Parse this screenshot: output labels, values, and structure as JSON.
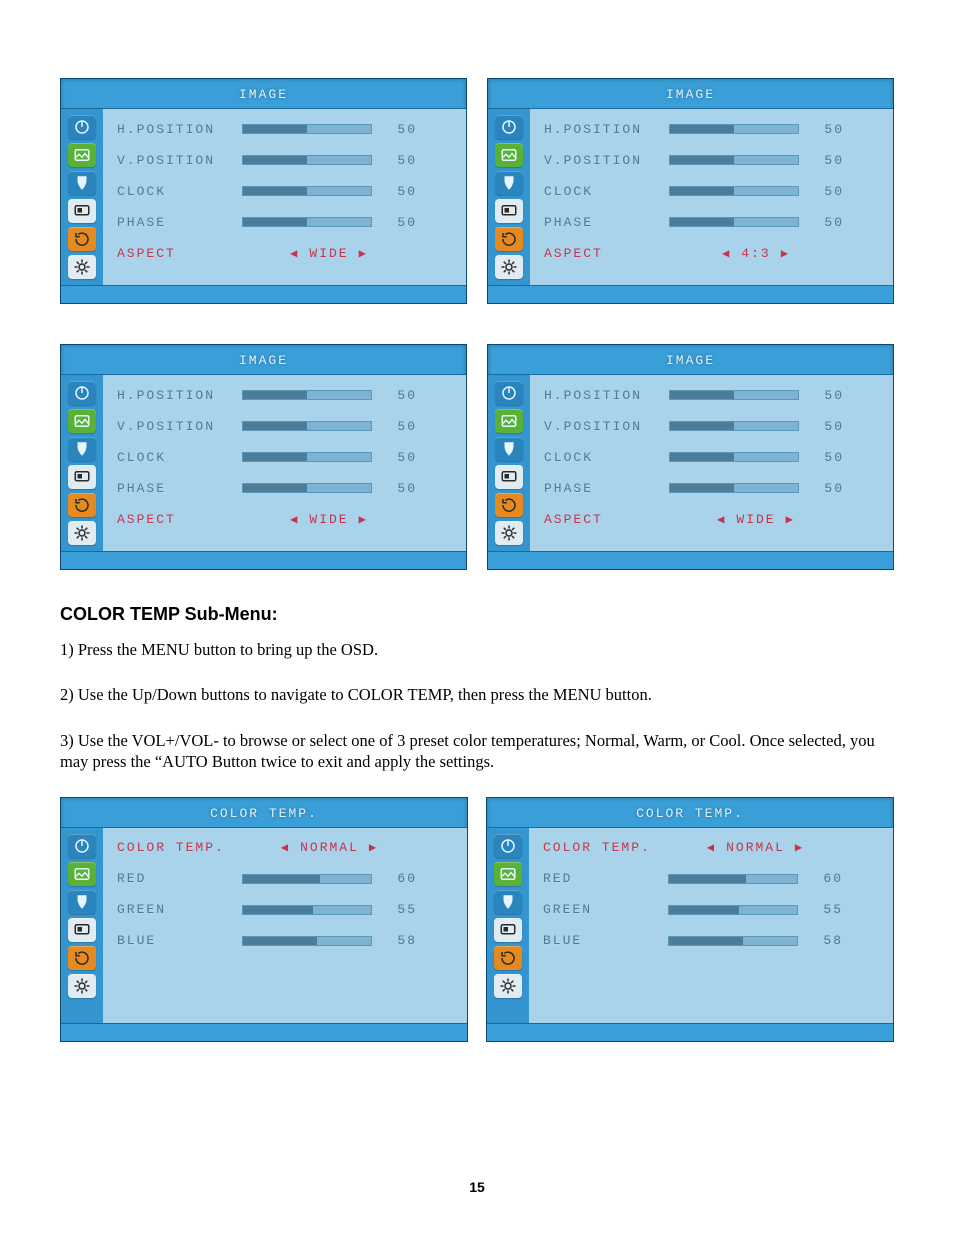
{
  "image_panels": [
    {
      "title": "IMAGE",
      "items": [
        {
          "label": "H.POSITION",
          "value": 50
        },
        {
          "label": "V.POSITION",
          "value": 50
        },
        {
          "label": "CLOCK",
          "value": 50
        },
        {
          "label": "PHASE",
          "value": 50
        }
      ],
      "aspect_label": "ASPECT",
      "aspect_value": "WIDE",
      "aspect_active": true
    },
    {
      "title": "IMAGE",
      "items": [
        {
          "label": "H.POSITION",
          "value": 50
        },
        {
          "label": "V.POSITION",
          "value": 50
        },
        {
          "label": "CLOCK",
          "value": 50
        },
        {
          "label": "PHASE",
          "value": 50
        }
      ],
      "aspect_label": "ASPECT",
      "aspect_value": "4:3",
      "aspect_active": true
    },
    {
      "title": "IMAGE",
      "items": [
        {
          "label": "H.POSITION",
          "value": 50
        },
        {
          "label": "V.POSITION",
          "value": 50
        },
        {
          "label": "CLOCK",
          "value": 50
        },
        {
          "label": "PHASE",
          "value": 50
        }
      ],
      "aspect_label": "ASPECT",
      "aspect_value": "WIDE",
      "aspect_active": true
    },
    {
      "title": "IMAGE",
      "items": [
        {
          "label": "H.POSITION",
          "value": 50
        },
        {
          "label": "V.POSITION",
          "value": 50
        },
        {
          "label": "CLOCK",
          "value": 50
        },
        {
          "label": "PHASE",
          "value": 50
        }
      ],
      "aspect_label": "ASPECT",
      "aspect_value": "WIDE",
      "aspect_active": true
    }
  ],
  "section_heading": "COLOR TEMP Sub-Menu:",
  "paragraphs": [
    "1) Press the MENU button to bring up the OSD.",
    "2) Use the Up/Down buttons to navigate to COLOR TEMP, then press the MENU button.",
    "3) Use the VOL+/VOL- to browse or select one of 3 preset color temperatures; Normal, Warm, or Cool. Once selected, you may press the “AUTO Button twice to exit and apply the settings."
  ],
  "color_panels": [
    {
      "title": "COLOR TEMP.",
      "ct_label": "COLOR TEMP.",
      "ct_value": "NORMAL",
      "ct_active": true,
      "items": [
        {
          "label": "RED",
          "value": 60
        },
        {
          "label": "GREEN",
          "value": 55
        },
        {
          "label": "BLUE",
          "value": 58
        }
      ]
    },
    {
      "title": "COLOR TEMP.",
      "ct_label": "COLOR TEMP.",
      "ct_value": "NORMAL",
      "ct_active": true,
      "items": [
        {
          "label": "RED",
          "value": 60
        },
        {
          "label": "GREEN",
          "value": 55
        },
        {
          "label": "BLUE",
          "value": 58
        }
      ]
    }
  ],
  "page_number": "15",
  "arrow_left": "◀",
  "arrow_right": "▶"
}
